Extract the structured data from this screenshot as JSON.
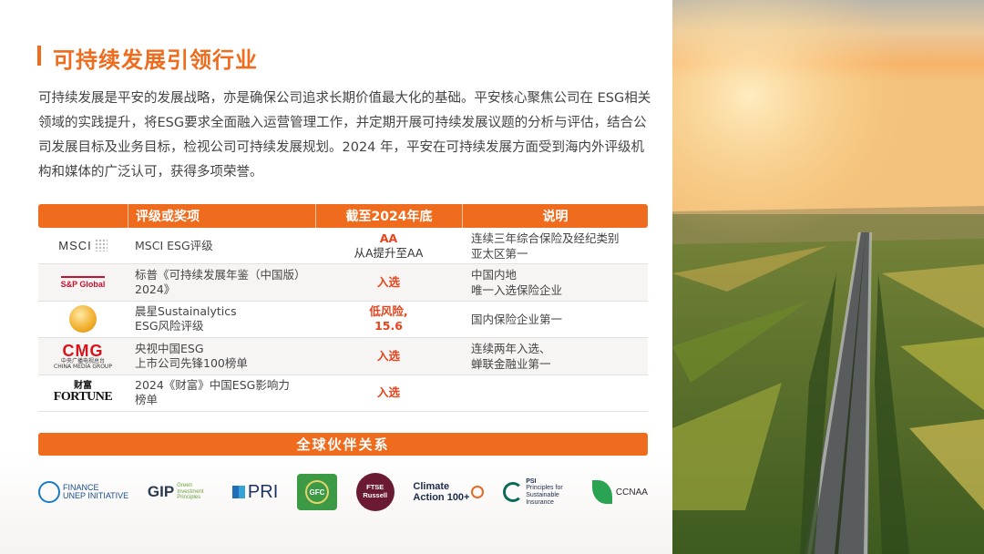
{
  "title": "可持续发展引领行业",
  "intro": "可持续发展是平安的发展战略，亦是确保公司追求长期价值最大化的基础。平安核心聚焦公司在 ESG相关领域的实践提升，将ESG要求全面融入运营管理工作，并定期开展可持续发展议题的分析与评估，结合公司发展目标及业务目标，检视公司可持续发展规划。2024 年，平安在可持续发展方面受到海内外评级机构和媒体的广泛认可，获得多项荣誉。",
  "table": {
    "headers": [
      "评级或奖项",
      "截至2024年底",
      "说明"
    ],
    "rows": [
      {
        "logo": "MSCI",
        "award": "MSCI ESG评级",
        "result_1": "AA",
        "result_2": "从A提升至AA",
        "note_1": "连续三年综合保险及经纪类别",
        "note_2": "亚太区第一"
      },
      {
        "logo": "S&P Global",
        "award_1": "标普《可持续发展年鉴（中国版）",
        "award_2": "2024》",
        "result": "入选",
        "note_1": "中国内地",
        "note_2": "唯一入选保险企业"
      },
      {
        "award_1": "晨星Sustainalytics",
        "award_2": "ESG风险评级",
        "result_1": "低风险,",
        "result_2": "15.6",
        "note": "国内保险企业第一"
      },
      {
        "logo_main": "CMG",
        "logo_cn": "中央广播电视总台",
        "logo_en": "CHINA MEDIA GROUP",
        "award_1": "央视中国ESG",
        "award_2": "上市公司先锋100榜单",
        "result": "入选",
        "note_1": "连续两年入选、",
        "note_2": "蝉联金融业第一"
      },
      {
        "logo_cn": "财富",
        "logo_en": "FORTUNE",
        "award_1": "2024《财富》中国ESG影响力",
        "award_2": "榜单",
        "result": "入选"
      }
    ]
  },
  "partners_title": "全球伙伴关系",
  "partners": {
    "unep_1": "FINANCE",
    "unep_2": "UNEP INITIATIVE",
    "gip": "GIP",
    "gip_sub": "Green Investment Principles",
    "pri": "PRI",
    "gfc": "GFC",
    "ftse_1": "FTSE",
    "ftse_2": "Russell",
    "climate_1": "Climate",
    "climate_2": "Action 100+",
    "psi_1": "PSI",
    "psi_2": "Principles for Sustainable Insurance",
    "ccnaa": "CCNAA"
  },
  "colors": {
    "accent": "#ef6b1d",
    "highlight": "#e8431b"
  }
}
